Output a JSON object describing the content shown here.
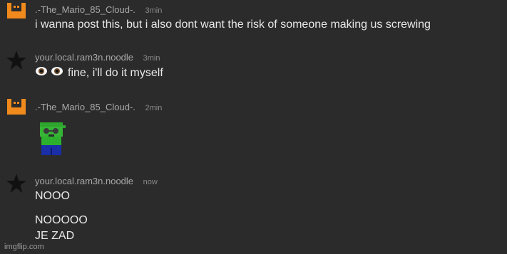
{
  "messages": [
    {
      "user": ".-The_Mario_85_Cloud-.",
      "time": "3min",
      "avatar": "orange-bucket-icon",
      "lines": [
        "i wanna post this, but i also dont want the risk of someone making us screwing"
      ]
    },
    {
      "user": "your.local.ram3n.noodle",
      "time": "3min",
      "avatar": "black-star-icon",
      "emoji": "eyes-emoji",
      "lines": [
        "fine, i'll do it myself"
      ]
    },
    {
      "user": ".-The_Mario_85_Cloud-.",
      "time": "2min",
      "avatar": "orange-bucket-icon",
      "image": "green-character-sprite"
    },
    {
      "user": "your.local.ram3n.noodle",
      "time": "now",
      "avatar": "black-star-icon",
      "lines": [
        "NOOO",
        "NOOOOO",
        "JE ZAD"
      ]
    }
  ],
  "colors": {
    "background": "#2b2b2b",
    "accent_orange": "#f08a1c",
    "star": "#111111"
  },
  "watermark": "imgflip.com"
}
